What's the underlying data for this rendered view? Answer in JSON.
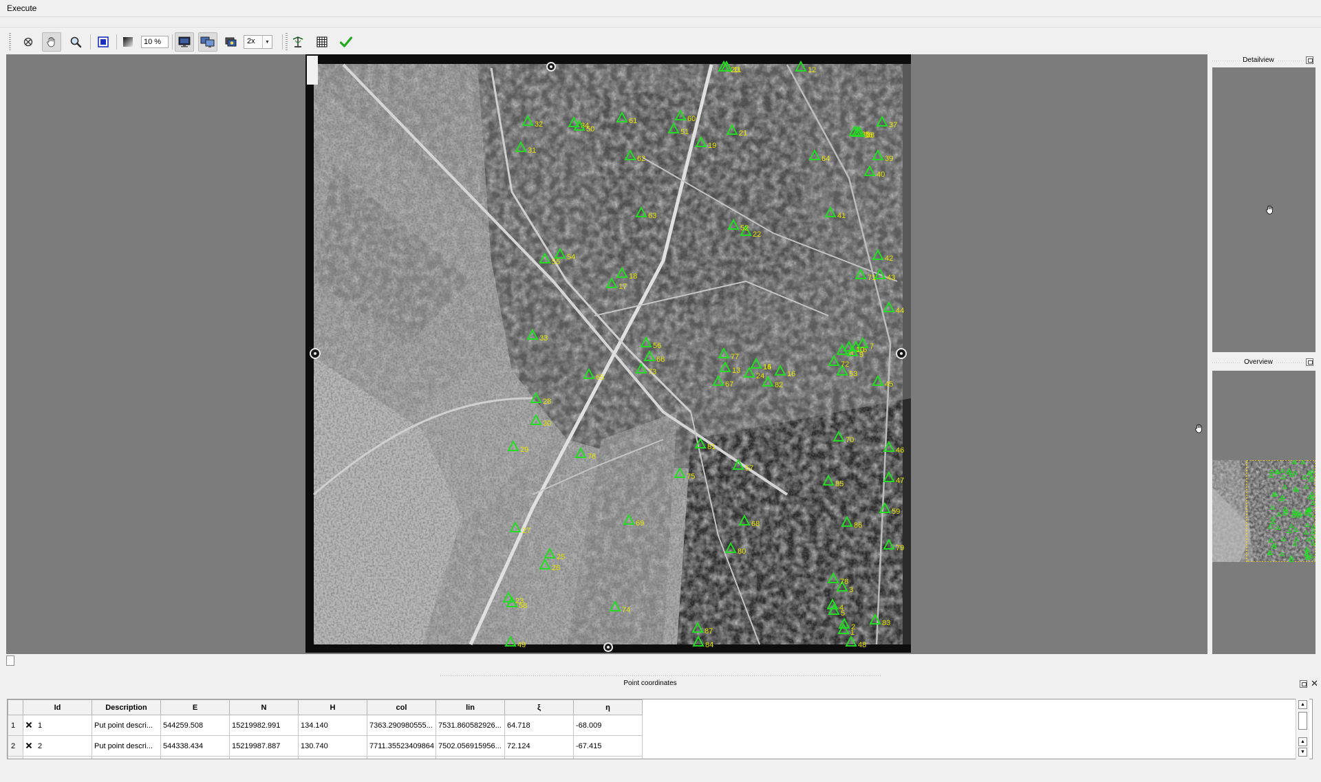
{
  "menu": {
    "execute_label": "Execute"
  },
  "toolbar": {
    "zoom_value": "10 %",
    "magnification_value": "2x",
    "icons": [
      "clear-selection-icon",
      "pan-hand-icon",
      "zoom-magnifier-icon",
      "zoom-fit-icon",
      "brightness-contrast-icon",
      "monitor-icon",
      "dual-monitor-icon",
      "camera-stack-icon",
      "transform-icon",
      "grid-table-icon",
      "checkmark-icon"
    ]
  },
  "colors": {
    "gcp_triangle": "#22dd22",
    "gcp_label": "#e6e600",
    "canvas_background": "#7c7c7c",
    "window_background": "#f0f0f0"
  },
  "viewer": {
    "gcp_labels": [
      "1",
      "2",
      "3",
      "4",
      "5",
      "6",
      "7",
      "8",
      "9",
      "10",
      "11",
      "12",
      "13",
      "14",
      "15",
      "16",
      "17",
      "18",
      "19",
      "20",
      "21",
      "22",
      "23",
      "24",
      "25",
      "26",
      "27",
      "28",
      "29",
      "30",
      "31",
      "32",
      "33",
      "34",
      "35",
      "36",
      "37",
      "38",
      "39",
      "40",
      "41",
      "42",
      "43",
      "44",
      "45",
      "46",
      "47",
      "48",
      "49",
      "50",
      "51",
      "52",
      "53",
      "54",
      "55",
      "56",
      "57",
      "58",
      "59",
      "60",
      "61",
      "62",
      "63",
      "64",
      "65",
      "66",
      "67",
      "68",
      "69",
      "70",
      "71",
      "72",
      "73",
      "74",
      "75",
      "76",
      "77",
      "78",
      "79",
      "80",
      "81",
      "82",
      "83",
      "84",
      "85",
      "86",
      "87"
    ],
    "cursor_icon": "hand-cursor-icon"
  },
  "docks": {
    "detailview_title": "Detailview",
    "overview_title": "Overview"
  },
  "point_coordinates": {
    "title": "Point coordinates",
    "columns": [
      "Id",
      "Description",
      "E",
      "N",
      "H",
      "col",
      "lin",
      "ξ",
      "η"
    ],
    "rows": [
      {
        "row_number": "1",
        "id": "1",
        "description": "Put point descri...",
        "e": "544259.508",
        "n": "15219982.991",
        "h": "134.140",
        "col": "7363.290980555...",
        "lin": "7531.860582926...",
        "xi": "64.718",
        "eta": "-68.009"
      },
      {
        "row_number": "2",
        "id": "2",
        "description": "Put point descri...",
        "e": "544338.434",
        "n": "15219987.887",
        "h": "130.740",
        "col": "7711.35523409864",
        "lin": "7502.056915956...",
        "xi": "72.124",
        "eta": "-67.415"
      }
    ]
  }
}
